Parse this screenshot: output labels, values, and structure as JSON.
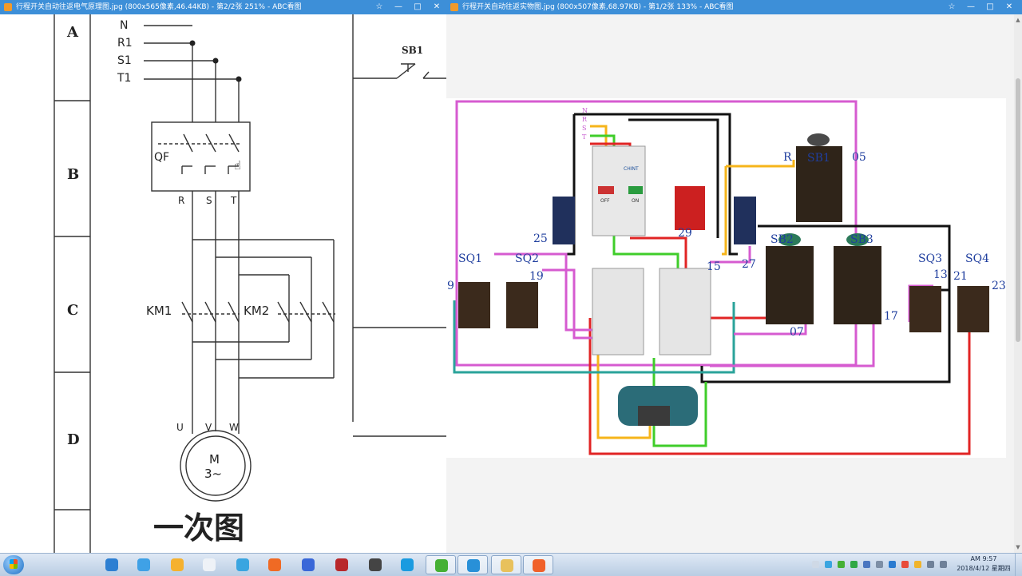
{
  "left_window": {
    "title": "行程开关自动往返电气原理图.jpg (800x565像素,46.44KB) - 第2/2张 251% - ABC看图",
    "buttons": [
      "☆",
      "—",
      "□",
      "✕"
    ],
    "diagram": {
      "row_labels": [
        "A",
        "B",
        "C",
        "D"
      ],
      "phases": [
        "N",
        "R1",
        "S1",
        "T1"
      ],
      "breaker": "QF",
      "breaker_terminals": [
        "R",
        "S",
        "T"
      ],
      "contactors": [
        "KM1",
        "KM2"
      ],
      "motor_terminals": [
        "U",
        "V",
        "W"
      ],
      "motor_label_1": "M",
      "motor_label_2": "3~",
      "caption": "一次图",
      "button_label": "SB1"
    }
  },
  "right_window": {
    "title": "行程开关自动往返实物图.jpg (800x507像素,68.97KB) - 第1/2张 133% - ABC看图",
    "buttons": [
      "☆",
      "—",
      "□",
      "✕"
    ],
    "photo": {
      "phase_letters": [
        "N",
        "R",
        "S",
        "T"
      ],
      "components": {
        "sb1": "SB1",
        "sb2": "SB2",
        "sb3": "SB3",
        "sq1": "SQ1",
        "sq2": "SQ2",
        "sq3": "SQ3",
        "sq4": "SQ4"
      },
      "wire_numbers": {
        "n25": "25",
        "n9": "9",
        "n19": "19",
        "n29": "29",
        "n15": "15",
        "n27": "27",
        "r": "R",
        "n05": "05",
        "n07": "07",
        "n17": "17",
        "n13": "13",
        "n21": "21",
        "n23": "23"
      },
      "breaker_labels": {
        "off": "OFF",
        "on": "ON",
        "brand": "CHINT"
      }
    }
  },
  "taskbar": {
    "apps": [
      {
        "name": "ie",
        "color": "#2d7fd2"
      },
      {
        "name": "baidu-netdisk",
        "color": "#3fa1e6"
      },
      {
        "name": "folder-tool",
        "color": "#f5b12e"
      },
      {
        "name": "blank-doc",
        "color": "#eef2f7"
      },
      {
        "name": "browser",
        "color": "#3aa5e0"
      },
      {
        "name": "orange-app",
        "color": "#f06a24"
      },
      {
        "name": "baidu-paw",
        "color": "#3967d8"
      },
      {
        "name": "game-red",
        "color": "#b8272a"
      },
      {
        "name": "game-dark",
        "color": "#444444"
      },
      {
        "name": "sogou",
        "color": "#1a9be0"
      },
      {
        "name": "green-browser",
        "color": "#45b034"
      },
      {
        "name": "qq-music",
        "color": "#2890d8"
      },
      {
        "name": "explorer",
        "color": "#e8c15c"
      },
      {
        "name": "abc-viewer",
        "color": "#f0612b"
      }
    ],
    "clock_time": "AM 9:57",
    "clock_date": "2018/4/12 星期四"
  }
}
